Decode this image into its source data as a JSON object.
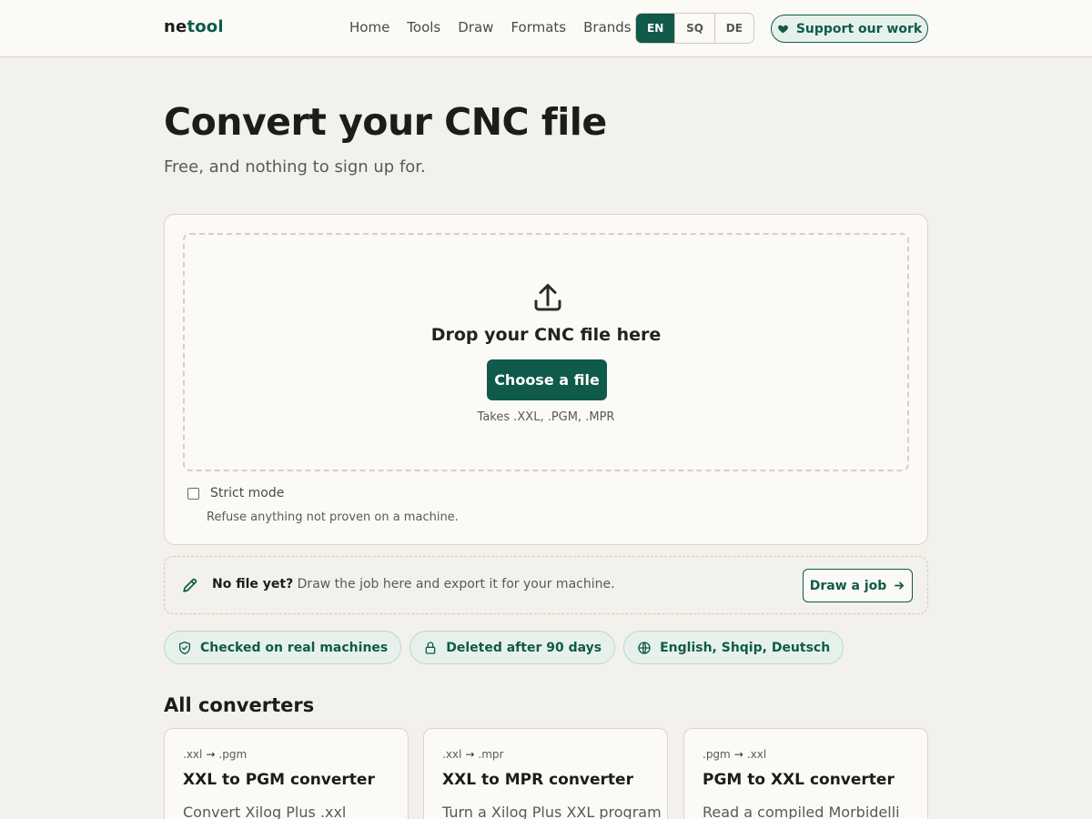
{
  "header": {
    "logo_part1": "ne",
    "logo_part2": "tool",
    "nav": [
      "Home",
      "Tools",
      "Draw",
      "Formats",
      "Brands"
    ],
    "languages": [
      "EN",
      "SQ",
      "DE"
    ],
    "active_language": "EN",
    "support_label": "Support our work",
    "support_icon": "heart-icon"
  },
  "hero": {
    "title": "Convert your CNC file",
    "subtitle": "Free, and nothing to sign up for."
  },
  "upload": {
    "icon": "upload-icon",
    "drop_text": "Drop your CNC file here",
    "choose_label": "Choose a file",
    "accepted": "Takes .XXL, .PGM, .MPR",
    "strict_label": "Strict mode",
    "strict_checked": false,
    "strict_help": "Refuse anything not proven on a machine."
  },
  "nofile": {
    "icon": "pencil-icon",
    "bold": "No file yet?",
    "text": " Draw the job here and export it for your machine.",
    "button_label": "Draw a job",
    "button_icon": "arrow-right-icon"
  },
  "badges": [
    {
      "icon": "shield-check-icon",
      "label": "Checked on real machines"
    },
    {
      "icon": "lock-icon",
      "label": "Deleted after 90 days"
    },
    {
      "icon": "globe-icon",
      "label": "English, Shqip, Deutsch"
    }
  ],
  "converters": {
    "title": "All converters",
    "items": [
      {
        "from": ".xxl",
        "to": ".pgm",
        "name": "XXL to PGM converter",
        "desc": "Convert Xilog Plus .xxl"
      },
      {
        "from": ".xxl",
        "to": ".mpr",
        "name": "XXL to MPR converter",
        "desc": "Turn a Xilog Plus XXL program"
      },
      {
        "from": ".pgm",
        "to": ".xxl",
        "name": "PGM to XXL converter",
        "desc": "Read a compiled Morbidelli"
      }
    ]
  },
  "colors": {
    "accent": "#0f5a4a",
    "background": "#f3f1ec",
    "card": "#fbfaf6",
    "badge_bg": "#e7f1ec"
  }
}
